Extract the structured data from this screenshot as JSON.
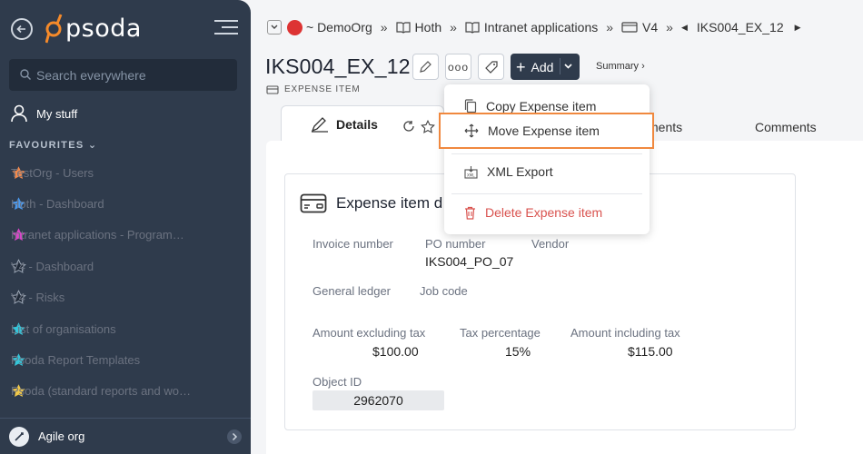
{
  "sidebar": {
    "logo_text": "psoda",
    "search_placeholder": "Search everywhere",
    "mystuff_label": "My stuff",
    "favourites_header": "FAVOURITES",
    "favourites": [
      {
        "label": "TestOrg - Users",
        "color": "#f58a4b"
      },
      {
        "label": "Hoth - Dashboard",
        "color": "#4a9af0"
      },
      {
        "label": "Intranet applications - Programme…",
        "color": "#d946c9"
      },
      {
        "label": "V4 - Dashboard",
        "color": "#1f2937"
      },
      {
        "label": "V4 - Risks",
        "color": "#1f2937"
      },
      {
        "label": "List of organisations",
        "color": "#35c5d9"
      },
      {
        "label": "Psoda Report Templates",
        "color": "#35c5d9"
      },
      {
        "label": "Psoda (standard reports and work…",
        "color": "#f0c84a"
      }
    ],
    "bottom_org": "Agile org"
  },
  "breadcrumb": {
    "org": "~ DemoOrg",
    "items": [
      "Hoth",
      "Intranet applications",
      "V4"
    ],
    "current": "IKS004_EX_12"
  },
  "header": {
    "title": "IKS004_EX_12",
    "add_label": "Add",
    "summary_label": "Summary ›",
    "subtype": "EXPENSE ITEM"
  },
  "tabs": {
    "details": "Details",
    "attachments_partial": "ments",
    "comments": "Comments"
  },
  "card": {
    "title": "Expense item d",
    "invoice_number_label": "Invoice number",
    "po_number_label": "PO number",
    "po_number_value": "IKS004_PO_07",
    "vendor_label": "Vendor",
    "general_ledger_label": "General ledger",
    "job_code_label": "Job code",
    "amount_excl_label": "Amount excluding tax",
    "amount_excl_value": "$100.00",
    "tax_pct_label": "Tax percentage",
    "tax_pct_value": "15%",
    "amount_incl_label": "Amount including tax",
    "amount_incl_value": "$115.00",
    "object_id_label": "Object ID",
    "object_id_value": "2962070"
  },
  "menu": {
    "copy": "Copy Expense item",
    "move": "Move Expense item",
    "xml": "XML Export",
    "delete": "Delete Expense item"
  },
  "colors": {
    "sidebar_bg": "#2f3b4c",
    "highlight": "#f0883e",
    "danger": "#d9534f"
  }
}
